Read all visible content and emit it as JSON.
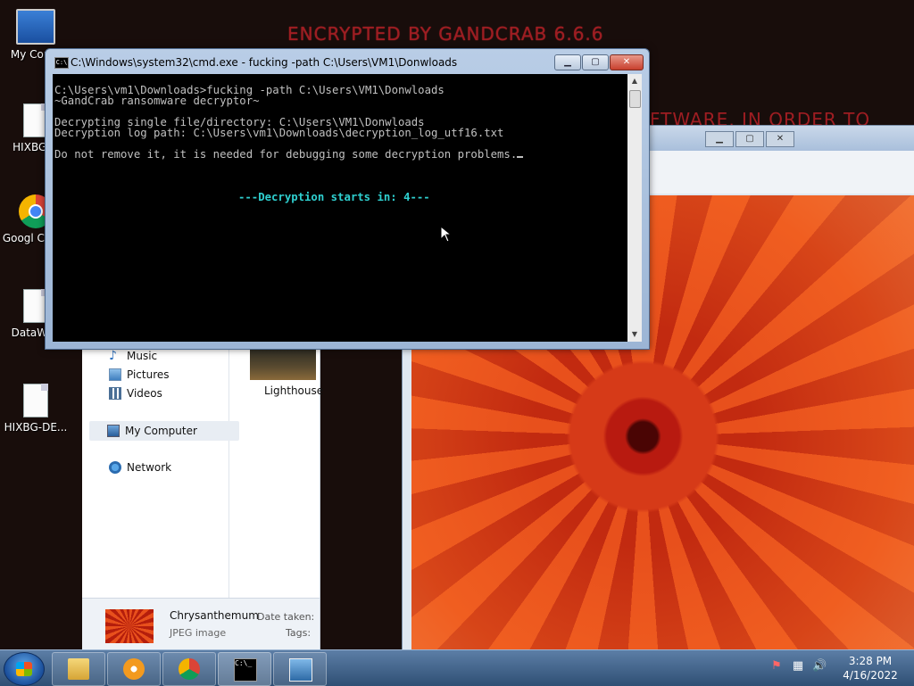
{
  "wallpaper": {
    "title": "ENCRYPTED BY GANDCRAB 6.6.6",
    "line2": "FTWARE, IN ORDER TO"
  },
  "desktop_icons": [
    {
      "label": "My Comp",
      "icon": "computer-icon"
    },
    {
      "label": "HIXBG-D",
      "icon": "document-icon"
    },
    {
      "label": "Googl Chron",
      "icon": "chrome-icon"
    },
    {
      "label": "DataWag",
      "icon": "document-icon"
    },
    {
      "label": "HIXBG-DE...",
      "icon": "document-icon"
    }
  ],
  "cmd": {
    "title": "C:\\Windows\\system32\\cmd.exe - fucking  -path C:\\Users\\VM1\\Donwloads",
    "icon_text": "C:\\",
    "min": "▁",
    "max": "▢",
    "close": "✕",
    "lines": [
      "C:\\Users\\vm1\\Downloads>fucking -path C:\\Users\\VM1\\Donwloads",
      "~GandCrab ransomware decryptor~",
      "Decrypting single file/directory: C:\\Users\\VM1\\Donwloads",
      "Decryption log path: C:\\Users\\vm1\\Downloads\\decryption_log_utf16.txt",
      "Do not remove it, it is needed for debugging some decryption problems."
    ],
    "countdown": "---Decryption starts in: 4---",
    "scroll_up": "▲",
    "scroll_down": "▼"
  },
  "explorer": {
    "nav": [
      {
        "label": "Music",
        "icon": "music-icon"
      },
      {
        "label": "Pictures",
        "icon": "pictures-icon"
      },
      {
        "label": "Videos",
        "icon": "videos-icon"
      },
      {
        "label": "My Computer",
        "icon": "computer-icon"
      },
      {
        "label": "Network",
        "icon": "network-icon"
      }
    ],
    "thumb_label": "Lighthouse",
    "details": {
      "name": "Chrysanthemum",
      "type": "JPEG image",
      "date_label": "Date taken:",
      "tags_label": "Tags:"
    }
  },
  "viewer": {
    "min": "▁",
    "max": "▢",
    "close": "✕"
  },
  "taskbar": {
    "buttons": [
      {
        "name": "explorer",
        "icon": "folder-icon"
      },
      {
        "name": "media-player",
        "icon": "media-player-icon"
      },
      {
        "name": "chrome",
        "icon": "chrome-icon"
      },
      {
        "name": "cmd",
        "icon": "cmd-icon",
        "text": "C:\\_"
      },
      {
        "name": "photo-viewer",
        "icon": "photo-viewer-icon"
      }
    ],
    "tray": {
      "flag": "⚑",
      "network": "▦",
      "volume": "🔊"
    },
    "clock": {
      "time": "3:28 PM",
      "date": "4/16/2022"
    }
  }
}
